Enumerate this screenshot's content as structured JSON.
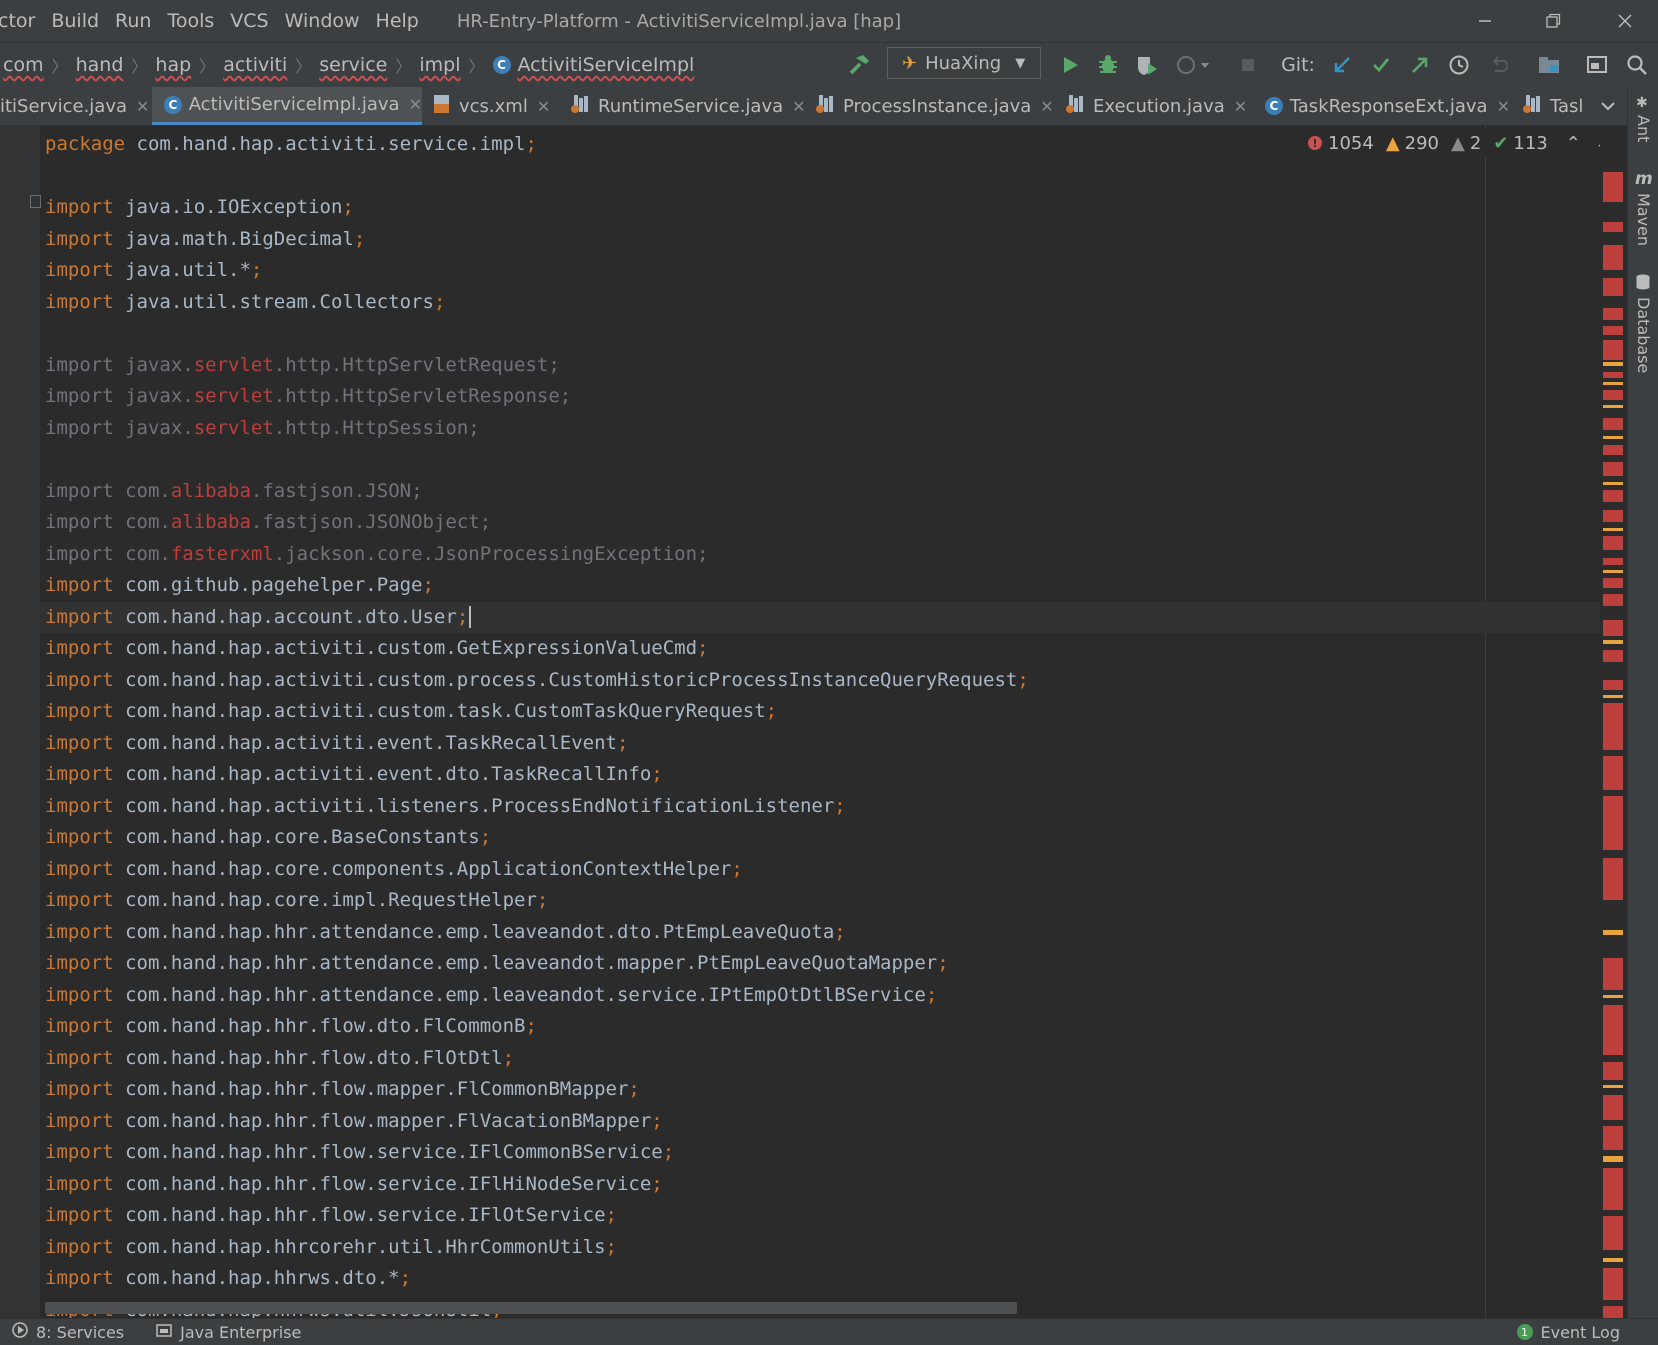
{
  "window": {
    "title": "HR-Entry-Platform - ActivitiServiceImpl.java [hap]",
    "menu": [
      "ctor",
      "Build",
      "Run",
      "Tools",
      "VCS",
      "Window",
      "Help"
    ],
    "controls": {
      "minimize": "minimize-icon",
      "restore": "restore-icon",
      "close": "close-icon"
    }
  },
  "navbar": {
    "breadcrumbs": [
      "com",
      "hand",
      "hap",
      "activiti",
      "service",
      "impl",
      "ActivitiServiceImpl"
    ],
    "run_config": "HuaXing",
    "git_label": "Git:"
  },
  "tabs": [
    {
      "label": "itiService.java",
      "icon": "interface-icon"
    },
    {
      "label": "ActivitiServiceImpl.java",
      "icon": "class-icon",
      "active": true
    },
    {
      "label": "vcs.xml",
      "icon": "xml-icon"
    },
    {
      "label": "RuntimeService.java",
      "icon": "library-class-icon"
    },
    {
      "label": "ProcessInstance.java",
      "icon": "library-class-icon"
    },
    {
      "label": "Execution.java",
      "icon": "library-class-icon"
    },
    {
      "label": "TaskResponseExt.java",
      "icon": "class-icon"
    },
    {
      "label": "Tasl",
      "icon": "library-class-icon"
    }
  ],
  "inspections": {
    "errors": "1054",
    "warnings": "290",
    "weak_warnings": "2",
    "typos": "113"
  },
  "code": {
    "package": "com.hand.hap.activiti.service.impl",
    "imports_block1": [
      "java.io.IOException",
      "java.math.BigDecimal",
      "java.util.*",
      "java.util.stream.Collectors"
    ],
    "imports_servlet": [
      {
        "pre": "javax.",
        "bad": "servlet",
        "post": ".http.HttpServletRequest"
      },
      {
        "pre": "javax.",
        "bad": "servlet",
        "post": ".http.HttpServletResponse"
      },
      {
        "pre": "javax.",
        "bad": "servlet",
        "post": ".http.HttpSession"
      }
    ],
    "imports_unresolved": [
      {
        "pre": "com.",
        "bad": "alibaba",
        "post": ".fastjson.JSON"
      },
      {
        "pre": "com.",
        "bad": "alibaba",
        "post": ".fastjson.JSONObject"
      },
      {
        "pre": "com.",
        "bad": "fasterxml",
        "post": ".jackson.core.JsonProcessingException"
      }
    ],
    "imports_block2": [
      "com.github.pagehelper.Page",
      "com.hand.hap.account.dto.User",
      "com.hand.hap.activiti.custom.GetExpressionValueCmd",
      "com.hand.hap.activiti.custom.process.CustomHistoricProcessInstanceQueryRequest",
      "com.hand.hap.activiti.custom.task.CustomTaskQueryRequest",
      "com.hand.hap.activiti.event.TaskRecallEvent",
      "com.hand.hap.activiti.event.dto.TaskRecallInfo",
      "com.hand.hap.activiti.listeners.ProcessEndNotificationListener",
      "com.hand.hap.core.BaseConstants",
      "com.hand.hap.core.components.ApplicationContextHelper",
      "com.hand.hap.core.impl.RequestHelper",
      "com.hand.hap.hhr.attendance.emp.leaveandot.dto.PtEmpLeaveQuota",
      "com.hand.hap.hhr.attendance.emp.leaveandot.mapper.PtEmpLeaveQuotaMapper",
      "com.hand.hap.hhr.attendance.emp.leaveandot.service.IPtEmpOtDtlBService",
      "com.hand.hap.hhr.flow.dto.FlCommonB",
      "com.hand.hap.hhr.flow.dto.FlOtDtl",
      "com.hand.hap.hhr.flow.mapper.FlCommonBMapper",
      "com.hand.hap.hhr.flow.mapper.FlVacationBMapper",
      "com.hand.hap.hhr.flow.service.IFlCommonBService",
      "com.hand.hap.hhr.flow.service.IFlHiNodeService",
      "com.hand.hap.hhr.flow.service.IFlOtService",
      "com.hand.hap.hhrcorehr.util.HhrCommonUtils",
      "com.hand.hap.hhrws.dto.*",
      "com.hand.hap.hhrws.util.JsonUtil"
    ],
    "keyword_package": "package",
    "keyword_import": "import"
  },
  "right_panel": [
    "Ant",
    "Maven",
    "Database"
  ],
  "status": {
    "services": "8: Services",
    "java_enterprise": "Java Enterprise",
    "event_log": "Event Log",
    "event_count": "1"
  },
  "colors": {
    "error": "#bc3f3c",
    "keyword": "#cc7832",
    "accent": "#4a88c7"
  }
}
